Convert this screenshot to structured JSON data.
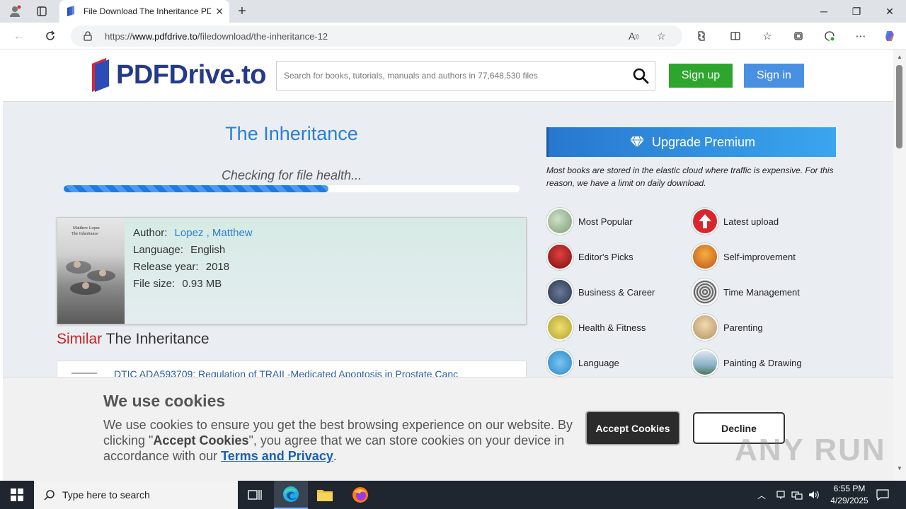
{
  "browser": {
    "tab_title": "File Download The Inheritance PDF",
    "url_prefix": "https://",
    "url_domain": "www.pdfdrive.to",
    "url_path": "/filedownload/the-inheritance-12"
  },
  "header": {
    "logo_text": "PDFDrive.to",
    "search_placeholder": "Search for books, tutorials, manuals and authors in 77,648,530 files",
    "signup_label": "Sign up",
    "signin_label": "Sign in"
  },
  "main": {
    "title": "The Inheritance",
    "status": "Checking for file health...",
    "progress": 0.58,
    "cover_author": "Matthew Lopez",
    "cover_title": "The Inheritance",
    "author_label": "Author:",
    "author_last": "Lopez",
    "author_first": ", Matthew",
    "language_label": "Language:",
    "language": "English",
    "year_label": "Release year:",
    "year": "2018",
    "size_label": "File size:",
    "size": "0.93 MB",
    "similar_prefix": "Similar",
    "similar_rest": " The Inheritance",
    "similar_item": "DTIC ADA593709: Regulation of TRAIL-Medicated Apoptosis in Prostate Canc"
  },
  "sidebar": {
    "premium_label": "Upgrade Premium",
    "note": "Most books are stored in the elastic cloud where traffic is expensive. For this reason, we have a limit on daily download.",
    "categories": [
      {
        "label": "Most Popular"
      },
      {
        "label": "Latest upload"
      },
      {
        "label": "Editor's Picks"
      },
      {
        "label": "Self-improvement"
      },
      {
        "label": "Business & Career"
      },
      {
        "label": "Time Management"
      },
      {
        "label": "Health & Fitness"
      },
      {
        "label": "Parenting"
      },
      {
        "label": "Language"
      },
      {
        "label": "Painting & Drawing"
      }
    ]
  },
  "cookie": {
    "title": "We use cookies",
    "text_1": "We use cookies to ensure you get the best browsing experience on our website. By clicking \"",
    "text_bold": "Accept Cookies",
    "text_2": "\", you agree that we can store cookies on your device in accordance with our ",
    "terms": "Terms and Privacy",
    "text_3": ".",
    "accept_label": "Accept Cookies",
    "decline_label": "Decline"
  },
  "watermark": "ANY RUN",
  "taskbar": {
    "search_placeholder": "Type here to search",
    "time": "6:55 PM",
    "date": "4/29/2025"
  },
  "colors": {
    "brand": "#263a8a",
    "link": "#2a7fd4",
    "signup": "#2ea62e",
    "signin": "#4a90e2"
  }
}
